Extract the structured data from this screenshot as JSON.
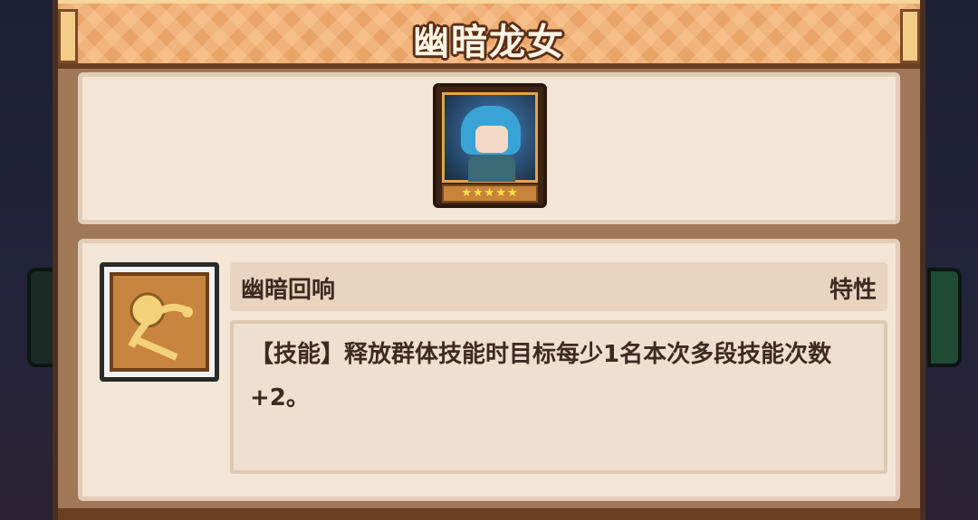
{
  "title": "幽暗龙女",
  "hero": {
    "portrait_icon": "blue-haired-dragon-girl-portrait",
    "stars": "★★★★★",
    "rarity_stars": 5
  },
  "skill": {
    "icon": "golden-orb-skill-icon",
    "name": "幽暗回响",
    "type": "特性",
    "description": "【技能】释放群体技能时目标每少1名本次多段技能次数+2。"
  },
  "colors": {
    "frame": "#a07757",
    "title_bar": "#e9a468",
    "panel": "#f4e6d7",
    "text": "#3d2a20",
    "star": "#ffe34a"
  }
}
